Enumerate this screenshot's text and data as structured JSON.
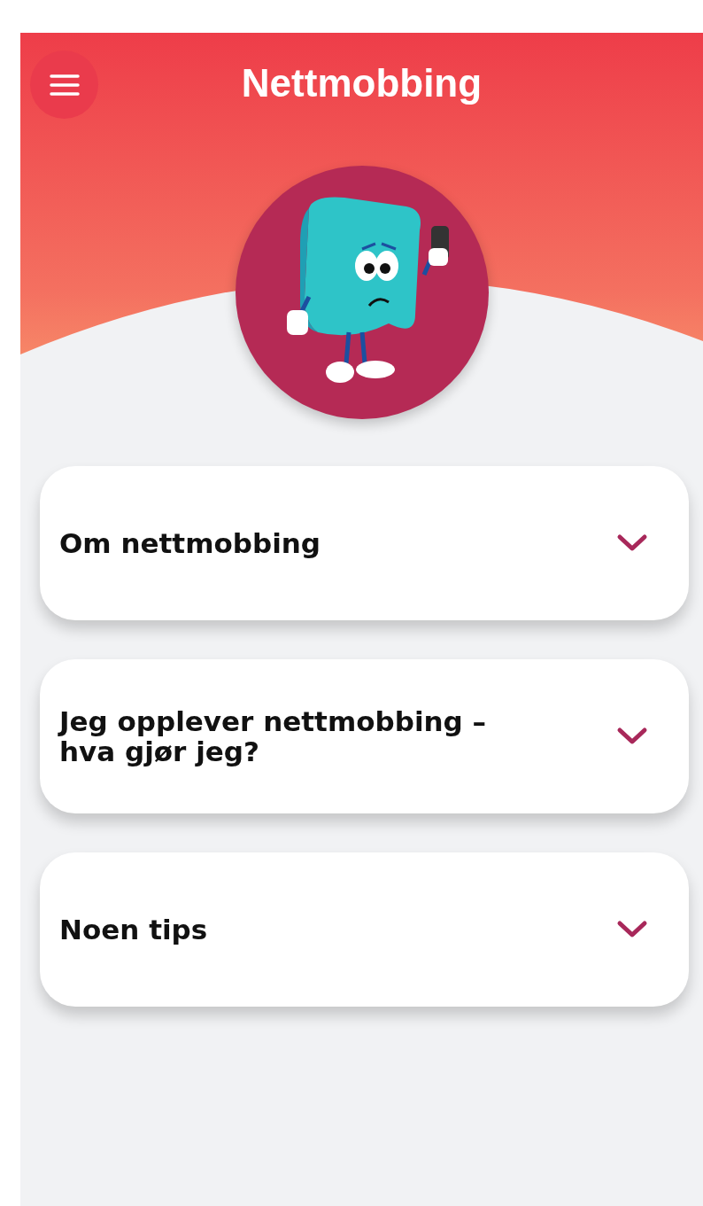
{
  "header": {
    "title": "Nettmobbing"
  },
  "sections": [
    {
      "title": "Om nettmobbing",
      "expanded": false
    },
    {
      "title": "Jeg opplever nettmobbing –\nhva gjør jeg?",
      "expanded": false
    },
    {
      "title": "Noen tips",
      "expanded": false
    }
  ]
}
